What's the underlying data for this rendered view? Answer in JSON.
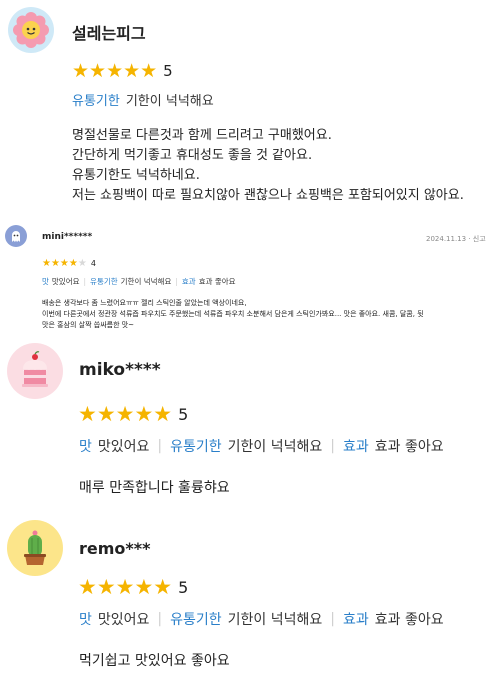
{
  "reviews": [
    {
      "user": "설레는피그",
      "stars": "★★★★★",
      "score": "5",
      "tags": [
        {
          "key": "유통기한",
          "value": "기한이 넉넉해요"
        }
      ],
      "body": [
        "명절선물로 다른것과 함께 드리려고 구매했어요.",
        "간단하게 먹기좋고 휴대성도 좋을 것 같아요.",
        "유통기한도 넉넉하네요.",
        "저는 쇼핑백이 따로 필요치않아 괜찮으나 쇼핑백은 포함되어있지 않아요."
      ]
    },
    {
      "user": "mini******",
      "date": "2024.11.13 · 신고",
      "stars": "★★★★",
      "star_empty": "★",
      "score": "4",
      "tags": [
        {
          "key": "맛",
          "value": "맛있어요"
        },
        {
          "key": "유통기한",
          "value": "기한이 넉넉해요"
        },
        {
          "key": "효과",
          "value": "효과 좋아요"
        }
      ],
      "body": [
        "배송은 생각보다  좀 느렸어요ㅠㅠ 젤리 스틱인줄 알았는데 액상이네요,",
        "이번에 다른곳에서 정관장 석류즙 파우치도 주문했는데 석류즙 파우치 소분해서 담은게 스틱인가봐요... 맛은 좋아요. 새콤, 달콤, 뒷",
        "맛은 홍삼의 살짝 씁싸름한 맛~"
      ]
    },
    {
      "user": "miko****",
      "stars": "★★★★★",
      "score": "5",
      "tags": [
        {
          "key": "맛",
          "value": "맛있어요"
        },
        {
          "key": "유통기한",
          "value": "기한이 넉넉해요"
        },
        {
          "key": "효과",
          "value": "효과 좋아요"
        }
      ],
      "body": [
        "매루 만족합니다 훌륭햐요"
      ]
    },
    {
      "user": "remo***",
      "stars": "★★★★★",
      "score": "5",
      "tags": [
        {
          "key": "맛",
          "value": "맛있어요"
        },
        {
          "key": "유통기한",
          "value": "기한이 넉넉해요"
        },
        {
          "key": "효과",
          "value": "효과 좋아요"
        }
      ],
      "body": [
        "먹기쉽고 맛있어요 좋아요"
      ]
    }
  ],
  "colors": {
    "star": "#f5b400",
    "tag_key": "#2a7fc9"
  },
  "icons": [
    "flower-avatar-icon",
    "ghost-avatar-icon",
    "cake-avatar-icon",
    "cactus-avatar-icon"
  ]
}
